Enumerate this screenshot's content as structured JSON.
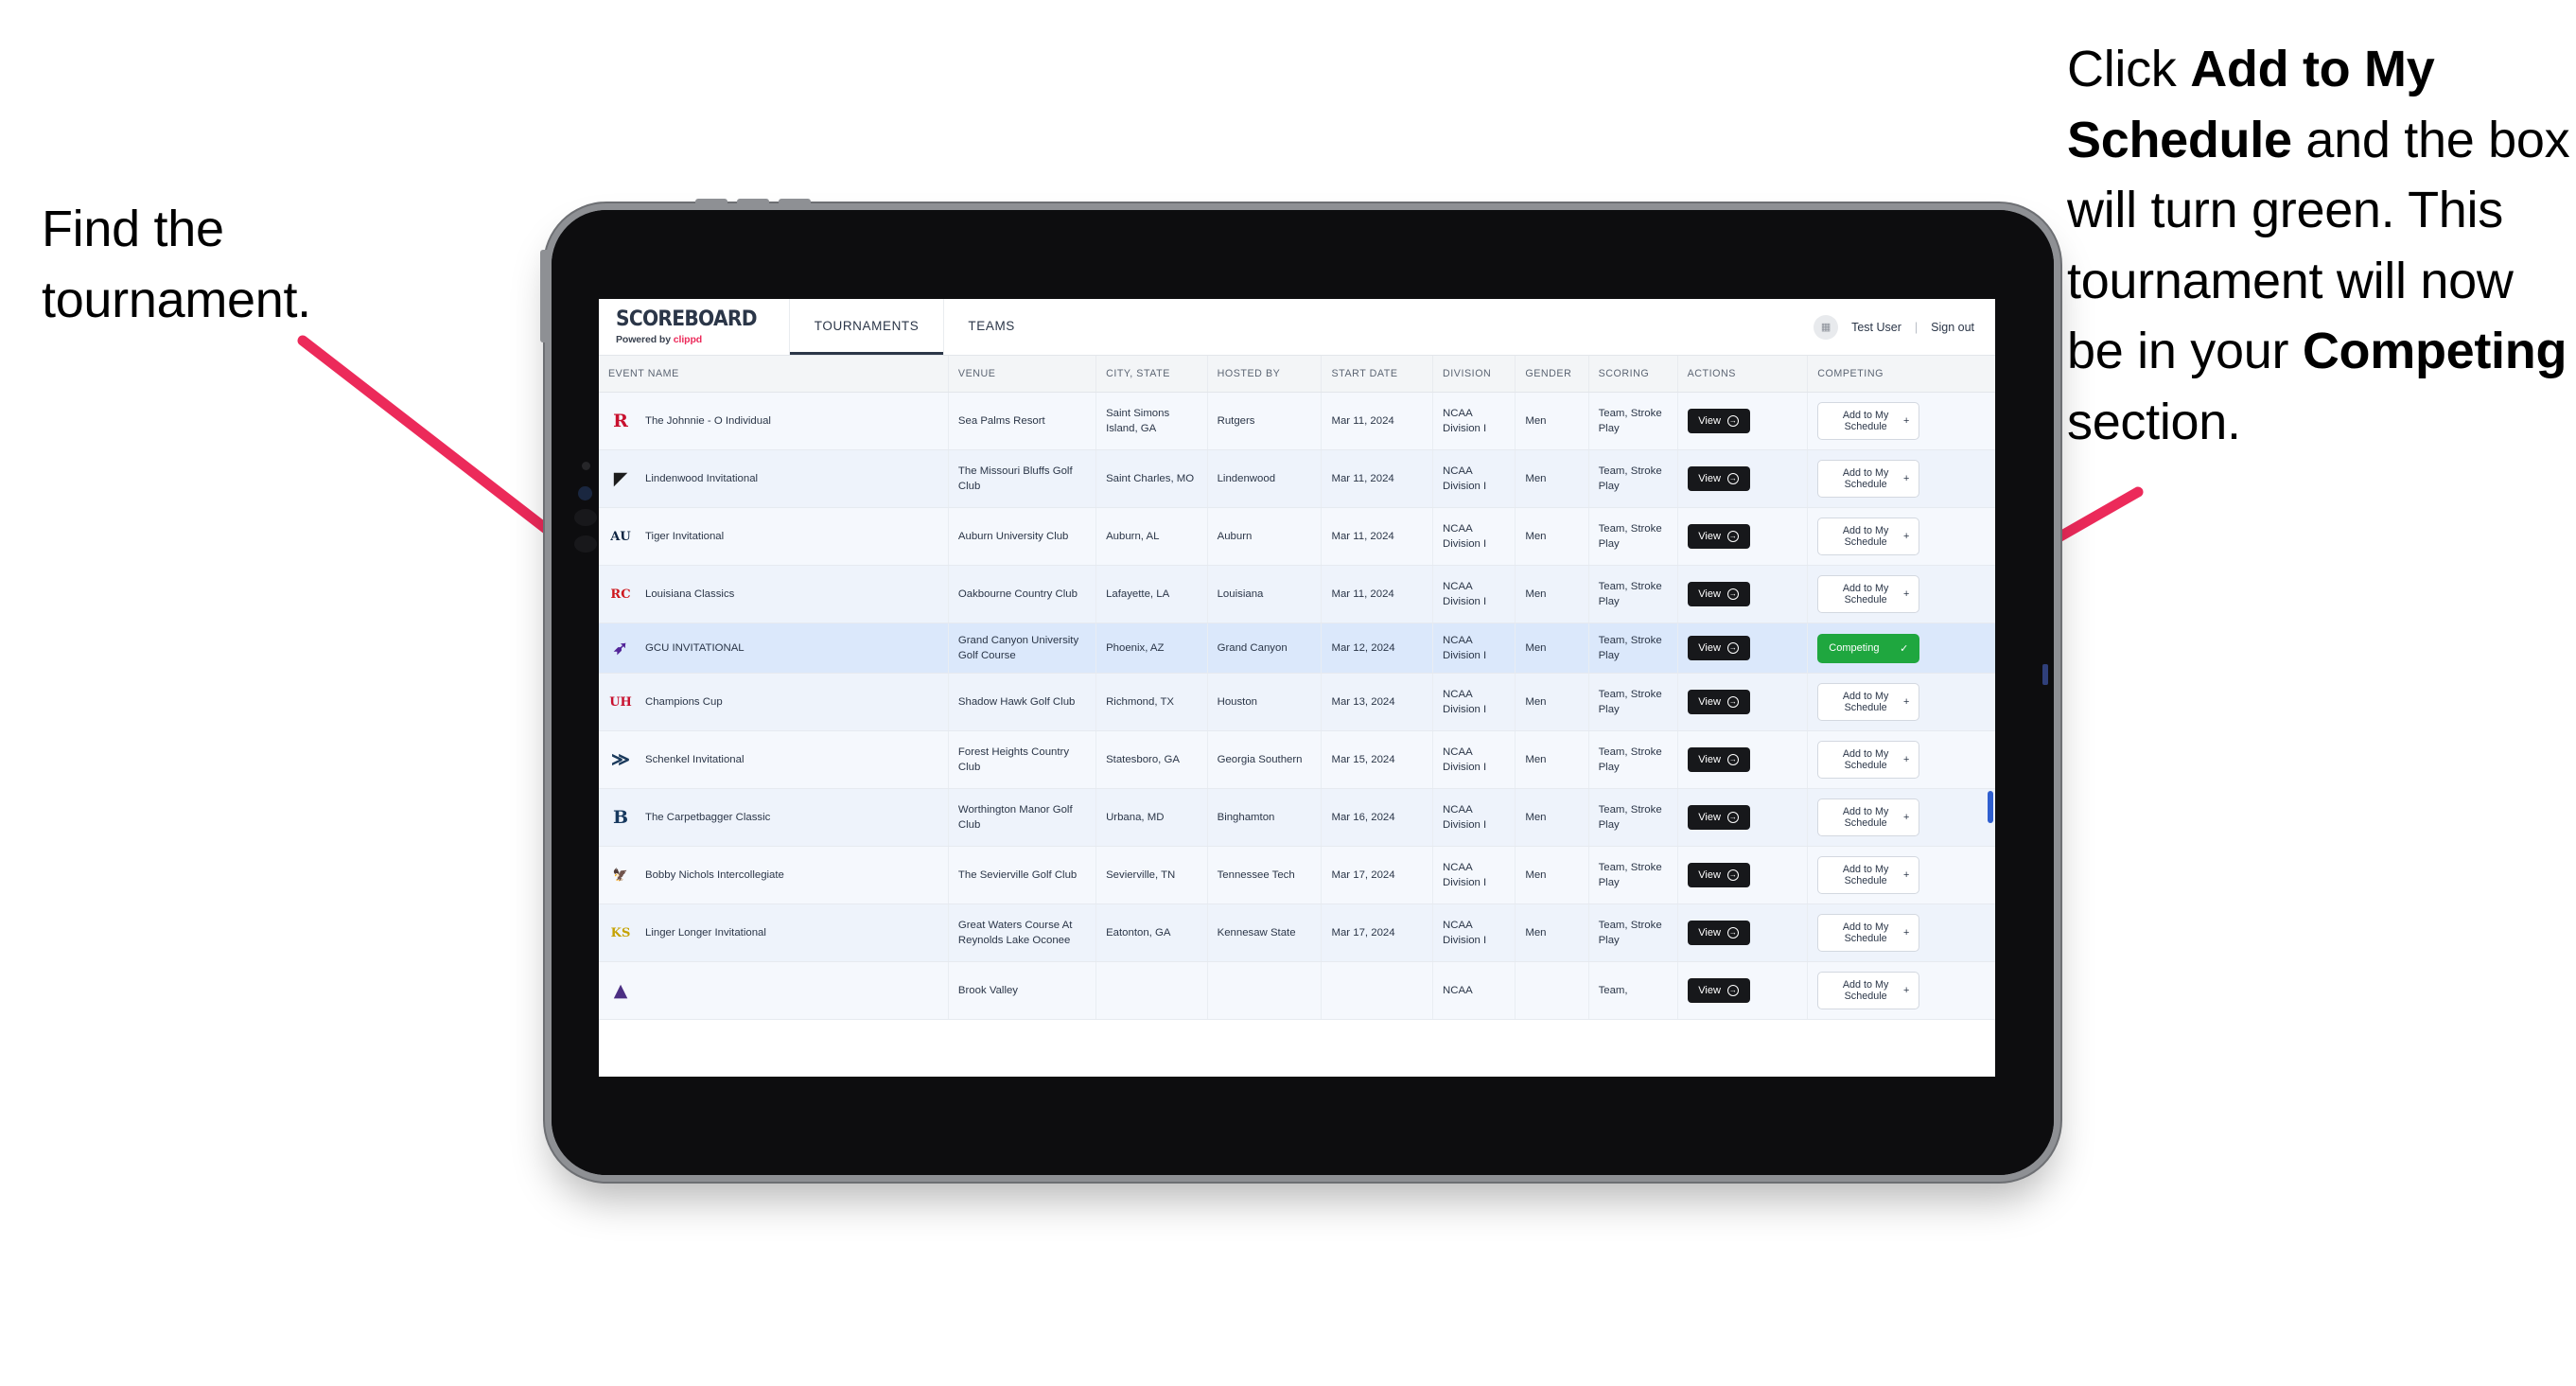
{
  "annotations": {
    "left": "Find the tournament.",
    "right_parts": [
      {
        "text": "Click ",
        "bold": false
      },
      {
        "text": "Add to My Schedule",
        "bold": true
      },
      {
        "text": " and the box will turn green. This tournament will now be in your ",
        "bold": false
      },
      {
        "text": "Competing",
        "bold": true
      },
      {
        "text": " section.",
        "bold": false
      }
    ],
    "arrow_color": "#ec2a5a"
  },
  "app": {
    "brand": {
      "title": "SCOREBOARD",
      "powered_prefix": "Powered by ",
      "powered_brand": "clippd"
    },
    "nav": {
      "tabs": [
        {
          "label": "TOURNAMENTS",
          "active": true
        },
        {
          "label": "TEAMS",
          "active": false
        }
      ]
    },
    "header_right": {
      "avatar_icon": "grid-icon",
      "user": "Test User",
      "separator": "|",
      "signout": "Sign out"
    }
  },
  "table": {
    "columns": [
      "EVENT NAME",
      "VENUE",
      "CITY, STATE",
      "HOSTED BY",
      "START DATE",
      "DIVISION",
      "GENDER",
      "SCORING",
      "ACTIONS",
      "COMPETING"
    ],
    "view_label": "View",
    "add_label": "Add to My Schedule",
    "add_icon": "+",
    "competing_label": "Competing",
    "competing_icon": "✓",
    "rows": [
      {
        "logo": {
          "name": "rutgers-logo",
          "glyph": "R",
          "color": "#c8102e",
          "bg": "transparent"
        },
        "event": "The Johnnie - O Individual",
        "venue": "Sea Palms Resort",
        "city": "Saint Simons Island, GA",
        "host": "Rutgers",
        "date": "Mar 11, 2024",
        "division": "NCAA Division I",
        "gender": "Men",
        "scoring": "Team, Stroke Play",
        "competing": false,
        "selected": false
      },
      {
        "logo": {
          "name": "lindenwood-logo",
          "glyph": "◤",
          "color": "#1c1c1c",
          "bg": "transparent"
        },
        "event": "Lindenwood Invitational",
        "venue": "The Missouri Bluffs Golf Club",
        "city": "Saint Charles, MO",
        "host": "Lindenwood",
        "date": "Mar 11, 2024",
        "division": "NCAA Division I",
        "gender": "Men",
        "scoring": "Team, Stroke Play",
        "competing": false,
        "selected": false
      },
      {
        "logo": {
          "name": "auburn-logo",
          "glyph": "AU",
          "color": "#0c2340",
          "bg": "transparent"
        },
        "event": "Tiger Invitational",
        "venue": "Auburn University Club",
        "city": "Auburn, AL",
        "host": "Auburn",
        "date": "Mar 11, 2024",
        "division": "NCAA Division I",
        "gender": "Men",
        "scoring": "Team, Stroke Play",
        "competing": false,
        "selected": false
      },
      {
        "logo": {
          "name": "louisiana-ragin-cajuns-logo",
          "glyph": "RC",
          "color": "#ce181e",
          "bg": "transparent"
        },
        "event": "Louisiana Classics",
        "venue": "Oakbourne Country Club",
        "city": "Lafayette, LA",
        "host": "Louisiana",
        "date": "Mar 11, 2024",
        "division": "NCAA Division I",
        "gender": "Men",
        "scoring": "Team, Stroke Play",
        "competing": false,
        "selected": false
      },
      {
        "logo": {
          "name": "grand-canyon-lopes-logo",
          "glyph": "➶",
          "color": "#522398",
          "bg": "transparent"
        },
        "event": "GCU INVITATIONAL",
        "venue": "Grand Canyon University Golf Course",
        "city": "Phoenix, AZ",
        "host": "Grand Canyon",
        "date": "Mar 12, 2024",
        "division": "NCAA Division I",
        "gender": "Men",
        "scoring": "Team, Stroke Play",
        "competing": true,
        "selected": true
      },
      {
        "logo": {
          "name": "houston-cougars-logo",
          "glyph": "UH",
          "color": "#c8102e",
          "bg": "transparent"
        },
        "event": "Champions Cup",
        "venue": "Shadow Hawk Golf Club",
        "city": "Richmond, TX",
        "host": "Houston",
        "date": "Mar 13, 2024",
        "division": "NCAA Division I",
        "gender": "Men",
        "scoring": "Team, Stroke Play",
        "competing": false,
        "selected": false
      },
      {
        "logo": {
          "name": "georgia-southern-eagles-logo",
          "glyph": "≫",
          "color": "#1a3a5c",
          "bg": "transparent"
        },
        "event": "Schenkel Invitational",
        "venue": "Forest Heights Country Club",
        "city": "Statesboro, GA",
        "host": "Georgia Southern",
        "date": "Mar 15, 2024",
        "division": "NCAA Division I",
        "gender": "Men",
        "scoring": "Team, Stroke Play",
        "competing": false,
        "selected": false
      },
      {
        "logo": {
          "name": "binghamton-bearcats-logo",
          "glyph": "B",
          "color": "#16385e",
          "bg": "transparent"
        },
        "event": "The Carpetbagger Classic",
        "venue": "Worthington Manor Golf Club",
        "city": "Urbana, MD",
        "host": "Binghamton",
        "date": "Mar 16, 2024",
        "division": "NCAA Division I",
        "gender": "Men",
        "scoring": "Team, Stroke Play",
        "competing": false,
        "selected": false
      },
      {
        "logo": {
          "name": "tennessee-tech-golden-eagles-logo",
          "glyph": "🦅",
          "color": "#6a2d8f",
          "bg": "transparent"
        },
        "event": "Bobby Nichols Intercollegiate",
        "venue": "The Sevierville Golf Club",
        "city": "Sevierville, TN",
        "host": "Tennessee Tech",
        "date": "Mar 17, 2024",
        "division": "NCAA Division I",
        "gender": "Men",
        "scoring": "Team, Stroke Play",
        "competing": false,
        "selected": false
      },
      {
        "logo": {
          "name": "kennesaw-state-owls-logo",
          "glyph": "KS",
          "color": "#c5a200",
          "bg": "transparent"
        },
        "event": "Linger Longer Invitational",
        "venue": "Great Waters Course At Reynolds Lake Oconee",
        "city": "Eatonton, GA",
        "host": "Kennesaw State",
        "date": "Mar 17, 2024",
        "division": "NCAA Division I",
        "gender": "Men",
        "scoring": "Team, Stroke Play",
        "competing": false,
        "selected": false
      },
      {
        "logo": {
          "name": "east-carolina-pirates-logo",
          "glyph": "▲",
          "color": "#4b2e83",
          "bg": "transparent"
        },
        "event": "",
        "venue": "Brook Valley",
        "city": "",
        "host": "",
        "date": "",
        "division": "NCAA",
        "gender": "",
        "scoring": "Team,",
        "competing": false,
        "selected": false,
        "clipped": true
      }
    ]
  }
}
